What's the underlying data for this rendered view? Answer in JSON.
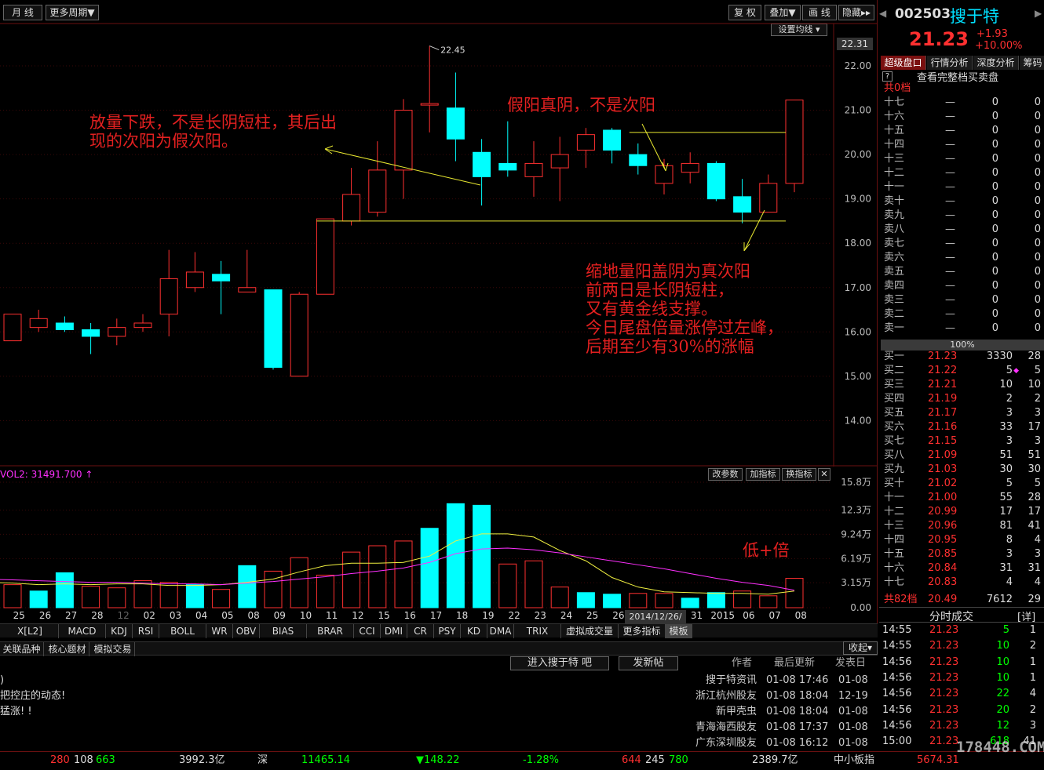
{
  "toolbar": {
    "period": "月 线",
    "more_period": "更多周期▼",
    "fuquan": "复 权",
    "overlay": "叠加▼",
    "draw": "画 线",
    "hide": "隐藏▸▸",
    "set_ma": "设置均线 ▾"
  },
  "stock": {
    "code": "002503",
    "name": "搜于特",
    "price": "21.23",
    "change": "+1.93",
    "change_pct": "+10.00%",
    "up_color": "#ff3030",
    "down_color": "#00ffff"
  },
  "right_tabs": [
    "超级盘口",
    "行情分析",
    "深度分析",
    "筹码"
  ],
  "orderbook": {
    "help": "?",
    "header": "查看完整档买卖盘",
    "total_label": "共0档",
    "percent": "100%",
    "asks": [
      {
        "label": "十七",
        "price": "—",
        "vol": "0",
        "n": "0"
      },
      {
        "label": "十六",
        "price": "—",
        "vol": "0",
        "n": "0"
      },
      {
        "label": "十五",
        "price": "—",
        "vol": "0",
        "n": "0"
      },
      {
        "label": "十四",
        "price": "—",
        "vol": "0",
        "n": "0"
      },
      {
        "label": "十三",
        "price": "—",
        "vol": "0",
        "n": "0"
      },
      {
        "label": "十二",
        "price": "—",
        "vol": "0",
        "n": "0"
      },
      {
        "label": "十一",
        "price": "—",
        "vol": "0",
        "n": "0"
      },
      {
        "label": "卖十",
        "price": "—",
        "vol": "0",
        "n": "0"
      },
      {
        "label": "卖九",
        "price": "—",
        "vol": "0",
        "n": "0"
      },
      {
        "label": "卖八",
        "price": "—",
        "vol": "0",
        "n": "0"
      },
      {
        "label": "卖七",
        "price": "—",
        "vol": "0",
        "n": "0"
      },
      {
        "label": "卖六",
        "price": "—",
        "vol": "0",
        "n": "0"
      },
      {
        "label": "卖五",
        "price": "—",
        "vol": "0",
        "n": "0"
      },
      {
        "label": "卖四",
        "price": "—",
        "vol": "0",
        "n": "0"
      },
      {
        "label": "卖三",
        "price": "—",
        "vol": "0",
        "n": "0"
      },
      {
        "label": "卖二",
        "price": "—",
        "vol": "0",
        "n": "0"
      },
      {
        "label": "卖一",
        "price": "—",
        "vol": "0",
        "n": "0"
      }
    ],
    "bids": [
      {
        "label": "买一",
        "price": "21.23",
        "vol": "3330",
        "n": "28"
      },
      {
        "label": "买二",
        "price": "21.22",
        "vol": "5",
        "n": "5"
      },
      {
        "label": "买三",
        "price": "21.21",
        "vol": "10",
        "n": "10"
      },
      {
        "label": "买四",
        "price": "21.19",
        "vol": "2",
        "n": "2"
      },
      {
        "label": "买五",
        "price": "21.17",
        "vol": "3",
        "n": "3"
      },
      {
        "label": "买六",
        "price": "21.16",
        "vol": "33",
        "n": "17"
      },
      {
        "label": "买七",
        "price": "21.15",
        "vol": "3",
        "n": "3"
      },
      {
        "label": "买八",
        "price": "21.09",
        "vol": "51",
        "n": "51"
      },
      {
        "label": "买九",
        "price": "21.03",
        "vol": "30",
        "n": "30"
      },
      {
        "label": "买十",
        "price": "21.02",
        "vol": "5",
        "n": "5"
      },
      {
        "label": "十一",
        "price": "21.00",
        "vol": "55",
        "n": "28"
      },
      {
        "label": "十二",
        "price": "20.99",
        "vol": "17",
        "n": "17"
      },
      {
        "label": "十三",
        "price": "20.96",
        "vol": "81",
        "n": "41"
      },
      {
        "label": "十四",
        "price": "20.95",
        "vol": "8",
        "n": "4"
      },
      {
        "label": "十五",
        "price": "20.85",
        "vol": "3",
        "n": "3"
      },
      {
        "label": "十六",
        "price": "20.84",
        "vol": "31",
        "n": "31"
      },
      {
        "label": "十七",
        "price": "20.83",
        "vol": "4",
        "n": "4"
      }
    ],
    "bid_total": {
      "label": "共82档",
      "price": "20.49",
      "vol": "7612",
      "n": "29"
    }
  },
  "ticks": {
    "title": "分时成交",
    "detail": "[详]",
    "rows": [
      {
        "time": "14:55",
        "price": "21.23",
        "vol": "5",
        "n": "1"
      },
      {
        "time": "14:55",
        "price": "21.23",
        "vol": "10",
        "n": "2"
      },
      {
        "time": "14:56",
        "price": "21.23",
        "vol": "10",
        "n": "1"
      },
      {
        "time": "14:56",
        "price": "21.23",
        "vol": "10",
        "n": "1"
      },
      {
        "time": "14:56",
        "price": "21.23",
        "vol": "22",
        "n": "4"
      },
      {
        "time": "14:56",
        "price": "21.23",
        "vol": "20",
        "n": "2"
      },
      {
        "time": "14:56",
        "price": "21.23",
        "vol": "12",
        "n": "3"
      },
      {
        "time": "15:00",
        "price": "21.23",
        "vol": "618",
        "n": "41"
      }
    ]
  },
  "chart_data": [
    {
      "type": "candlestick",
      "price_axis": [
        "22.00",
        "21.00",
        "20.00",
        "19.00",
        "18.00",
        "17.00",
        "16.00",
        "15.00",
        "14.00"
      ],
      "ylim": [
        13.5,
        22.75
      ],
      "current_price_tag": "22.31",
      "high_marker": "22.45",
      "x": [
        "25",
        "26",
        "27",
        "28",
        "12",
        "02",
        "03",
        "04",
        "05",
        "08",
        "09",
        "10",
        "11",
        "12",
        "15",
        "16",
        "17",
        "18",
        "19",
        "22",
        "23",
        "24",
        "25",
        "26",
        "29",
        "30",
        "31",
        "2015",
        "06",
        "07",
        "08"
      ],
      "hover_date": "2014/12/26/五",
      "candles": [
        {
          "o": 15.8,
          "h": 16.4,
          "l": 15.8,
          "c": 16.4
        },
        {
          "o": 16.1,
          "h": 16.5,
          "l": 16.0,
          "c": 16.3
        },
        {
          "o": 16.2,
          "h": 16.35,
          "l": 16.0,
          "c": 16.05
        },
        {
          "o": 16.05,
          "h": 16.2,
          "l": 15.5,
          "c": 15.9
        },
        {
          "o": 15.9,
          "h": 16.3,
          "l": 15.7,
          "c": 16.1
        },
        {
          "o": 16.1,
          "h": 16.4,
          "l": 16.0,
          "c": 16.2
        },
        {
          "o": 16.4,
          "h": 17.85,
          "l": 15.9,
          "c": 17.2
        },
        {
          "o": 17.0,
          "h": 17.8,
          "l": 16.9,
          "c": 17.35
        },
        {
          "o": 17.3,
          "h": 17.6,
          "l": 16.4,
          "c": 17.15
        },
        {
          "o": 16.9,
          "h": 17.85,
          "l": 16.9,
          "c": 17.0
        },
        {
          "o": 16.95,
          "h": 16.95,
          "l": 15.15,
          "c": 15.2
        },
        {
          "o": 15.0,
          "h": 16.9,
          "l": 15.0,
          "c": 16.85
        },
        {
          "o": 16.85,
          "h": 18.55,
          "l": 16.85,
          "c": 18.55
        },
        {
          "o": 18.5,
          "h": 19.7,
          "l": 18.4,
          "c": 19.1
        },
        {
          "o": 18.7,
          "h": 20.3,
          "l": 18.6,
          "c": 19.65
        },
        {
          "o": 19.65,
          "h": 21.25,
          "l": 19.0,
          "c": 21.0
        },
        {
          "o": 21.15,
          "h": 22.45,
          "l": 20.5,
          "c": 21.15
        },
        {
          "o": 21.05,
          "h": 21.85,
          "l": 19.85,
          "c": 20.35
        },
        {
          "o": 20.05,
          "h": 20.35,
          "l": 18.85,
          "c": 19.5
        },
        {
          "o": 19.8,
          "h": 20.75,
          "l": 19.5,
          "c": 19.65
        },
        {
          "o": 19.5,
          "h": 20.3,
          "l": 19.05,
          "c": 19.8
        },
        {
          "o": 19.7,
          "h": 20.4,
          "l": 18.95,
          "c": 20.0
        },
        {
          "o": 20.1,
          "h": 20.6,
          "l": 19.7,
          "c": 20.45
        },
        {
          "o": 20.55,
          "h": 20.6,
          "l": 19.8,
          "c": 20.1
        },
        {
          "o": 20.0,
          "h": 20.25,
          "l": 19.55,
          "c": 19.75
        },
        {
          "o": 19.35,
          "h": 19.9,
          "l": 19.1,
          "c": 19.75
        },
        {
          "o": 19.6,
          "h": 20.05,
          "l": 19.35,
          "c": 19.8
        },
        {
          "o": 19.8,
          "h": 19.85,
          "l": 18.95,
          "c": 19.0
        },
        {
          "o": 19.05,
          "h": 19.45,
          "l": 18.45,
          "c": 18.7
        },
        {
          "o": 18.7,
          "h": 19.55,
          "l": 18.7,
          "c": 19.35
        },
        {
          "o": 19.35,
          "h": 21.23,
          "l": 19.15,
          "c": 21.23
        }
      ],
      "lines": [
        {
          "x1": 12,
          "y1": 18.5,
          "x2": 30,
          "y2": 18.5
        },
        {
          "x1": 24,
          "y1": 20.5,
          "x2": 30,
          "y2": 20.5
        }
      ]
    },
    {
      "type": "bar",
      "label": "VOL2: 31491.700 ↑",
      "vol_axis": [
        "15.8万",
        "12.3万",
        "9.24万",
        "6.19万",
        "3.15万",
        "0.00"
      ],
      "ylim": [
        0,
        15.8
      ],
      "values": [
        3.0,
        2.9,
        2.1,
        4.4,
        2.7,
        2.5,
        3.4,
        3.2,
        2.9,
        2.3,
        5.3,
        4.6,
        6.3,
        4.1,
        7.0,
        7.8,
        8.4,
        10.0,
        13.1,
        12.9,
        5.5,
        5.9,
        2.6,
        1.9,
        1.7,
        1.8,
        1.8,
        1.2,
        1.9,
        2.1,
        1.5,
        3.7
      ],
      "ma5": [
        3.2,
        3.1,
        2.9,
        3.0,
        2.9,
        3.0,
        3.0,
        2.8,
        2.8,
        2.9,
        3.2,
        3.6,
        4.5,
        5.3,
        5.6,
        5.6,
        5.7,
        6.5,
        8.4,
        9.3,
        9.3,
        8.9,
        7.2,
        5.9,
        3.8,
        2.6,
        2.0,
        1.9,
        1.8,
        1.8,
        1.7,
        2.1
      ],
      "ma10": [
        3.6,
        3.5,
        3.4,
        3.3,
        3.2,
        3.2,
        3.1,
        3.0,
        3.0,
        2.9,
        3.1,
        3.3,
        3.6,
        3.9,
        4.3,
        4.6,
        5.0,
        5.7,
        6.8,
        7.4,
        7.5,
        7.3,
        6.9,
        6.4,
        5.9,
        5.4,
        4.9,
        4.3,
        3.7,
        3.2,
        2.8,
        2.2
      ],
      "annotation": "低+倍",
      "buttons": [
        "改参数",
        "加指标",
        "换指标",
        "✕"
      ]
    }
  ],
  "annotations": {
    "a1": "放量下跌，不是长阴短柱，其后出\n现的次阳为假次阳。",
    "a2": "假阳真阴，不是次阳",
    "a3": "缩地量阳盖阴为真次阳\n前两日是长阴短柱，\n又有黄金线支撑。\n今日尾盘倍量涨停过左峰，\n后期至少有30%的涨幅"
  },
  "indicator_tabs": [
    "X[L2]",
    "MACD",
    "KDJ",
    "RSI",
    "BOLL",
    "WR",
    "OBV",
    "BIAS",
    "BRAR",
    "CCI",
    "DMI",
    "CR",
    "PSY",
    "KD",
    "DMA",
    "TRIX",
    "虚拟成交量",
    "更多指标",
    "模板"
  ],
  "bottom_tabs": [
    "关联品种",
    "核心题材",
    "模拟交易"
  ],
  "collapse": "收起▾",
  "forum": {
    "enter": "进入搜于特 吧",
    "post": "发新帖",
    "col_author": "作者",
    "col_update": "最后更新",
    "col_date": "发表日",
    "left_lines": [
      ")",
      "把控庄的动态!",
      "猛涨! !"
    ],
    "rows": [
      {
        "author": "搜于特资讯",
        "update": "01-08 17:46",
        "date": "01-08"
      },
      {
        "author": "浙江杭州股友",
        "update": "01-08 18:04",
        "date": "12-19"
      },
      {
        "author": "新甲壳虫",
        "update": "01-08 18:04",
        "date": "01-08"
      },
      {
        "author": "青海海西股友",
        "update": "01-08 17:37",
        "date": "01-08"
      },
      {
        "author": "广东深圳股友",
        "update": "01-08 16:12",
        "date": "01-08"
      }
    ]
  },
  "statusbar": {
    "sh_counts": [
      "280",
      "108",
      "663"
    ],
    "sh_amount": "3992.3亿",
    "sz_label": "深",
    "sz_index": "11465.14",
    "sz_change": "▼148.22",
    "sz_pct": "-1.28%",
    "sz_counts": [
      "644",
      "245",
      "780"
    ],
    "sz_amount": "2389.7亿",
    "board_label": "中小板指",
    "board_index": "5674.31"
  },
  "watermark": "178448.COM"
}
